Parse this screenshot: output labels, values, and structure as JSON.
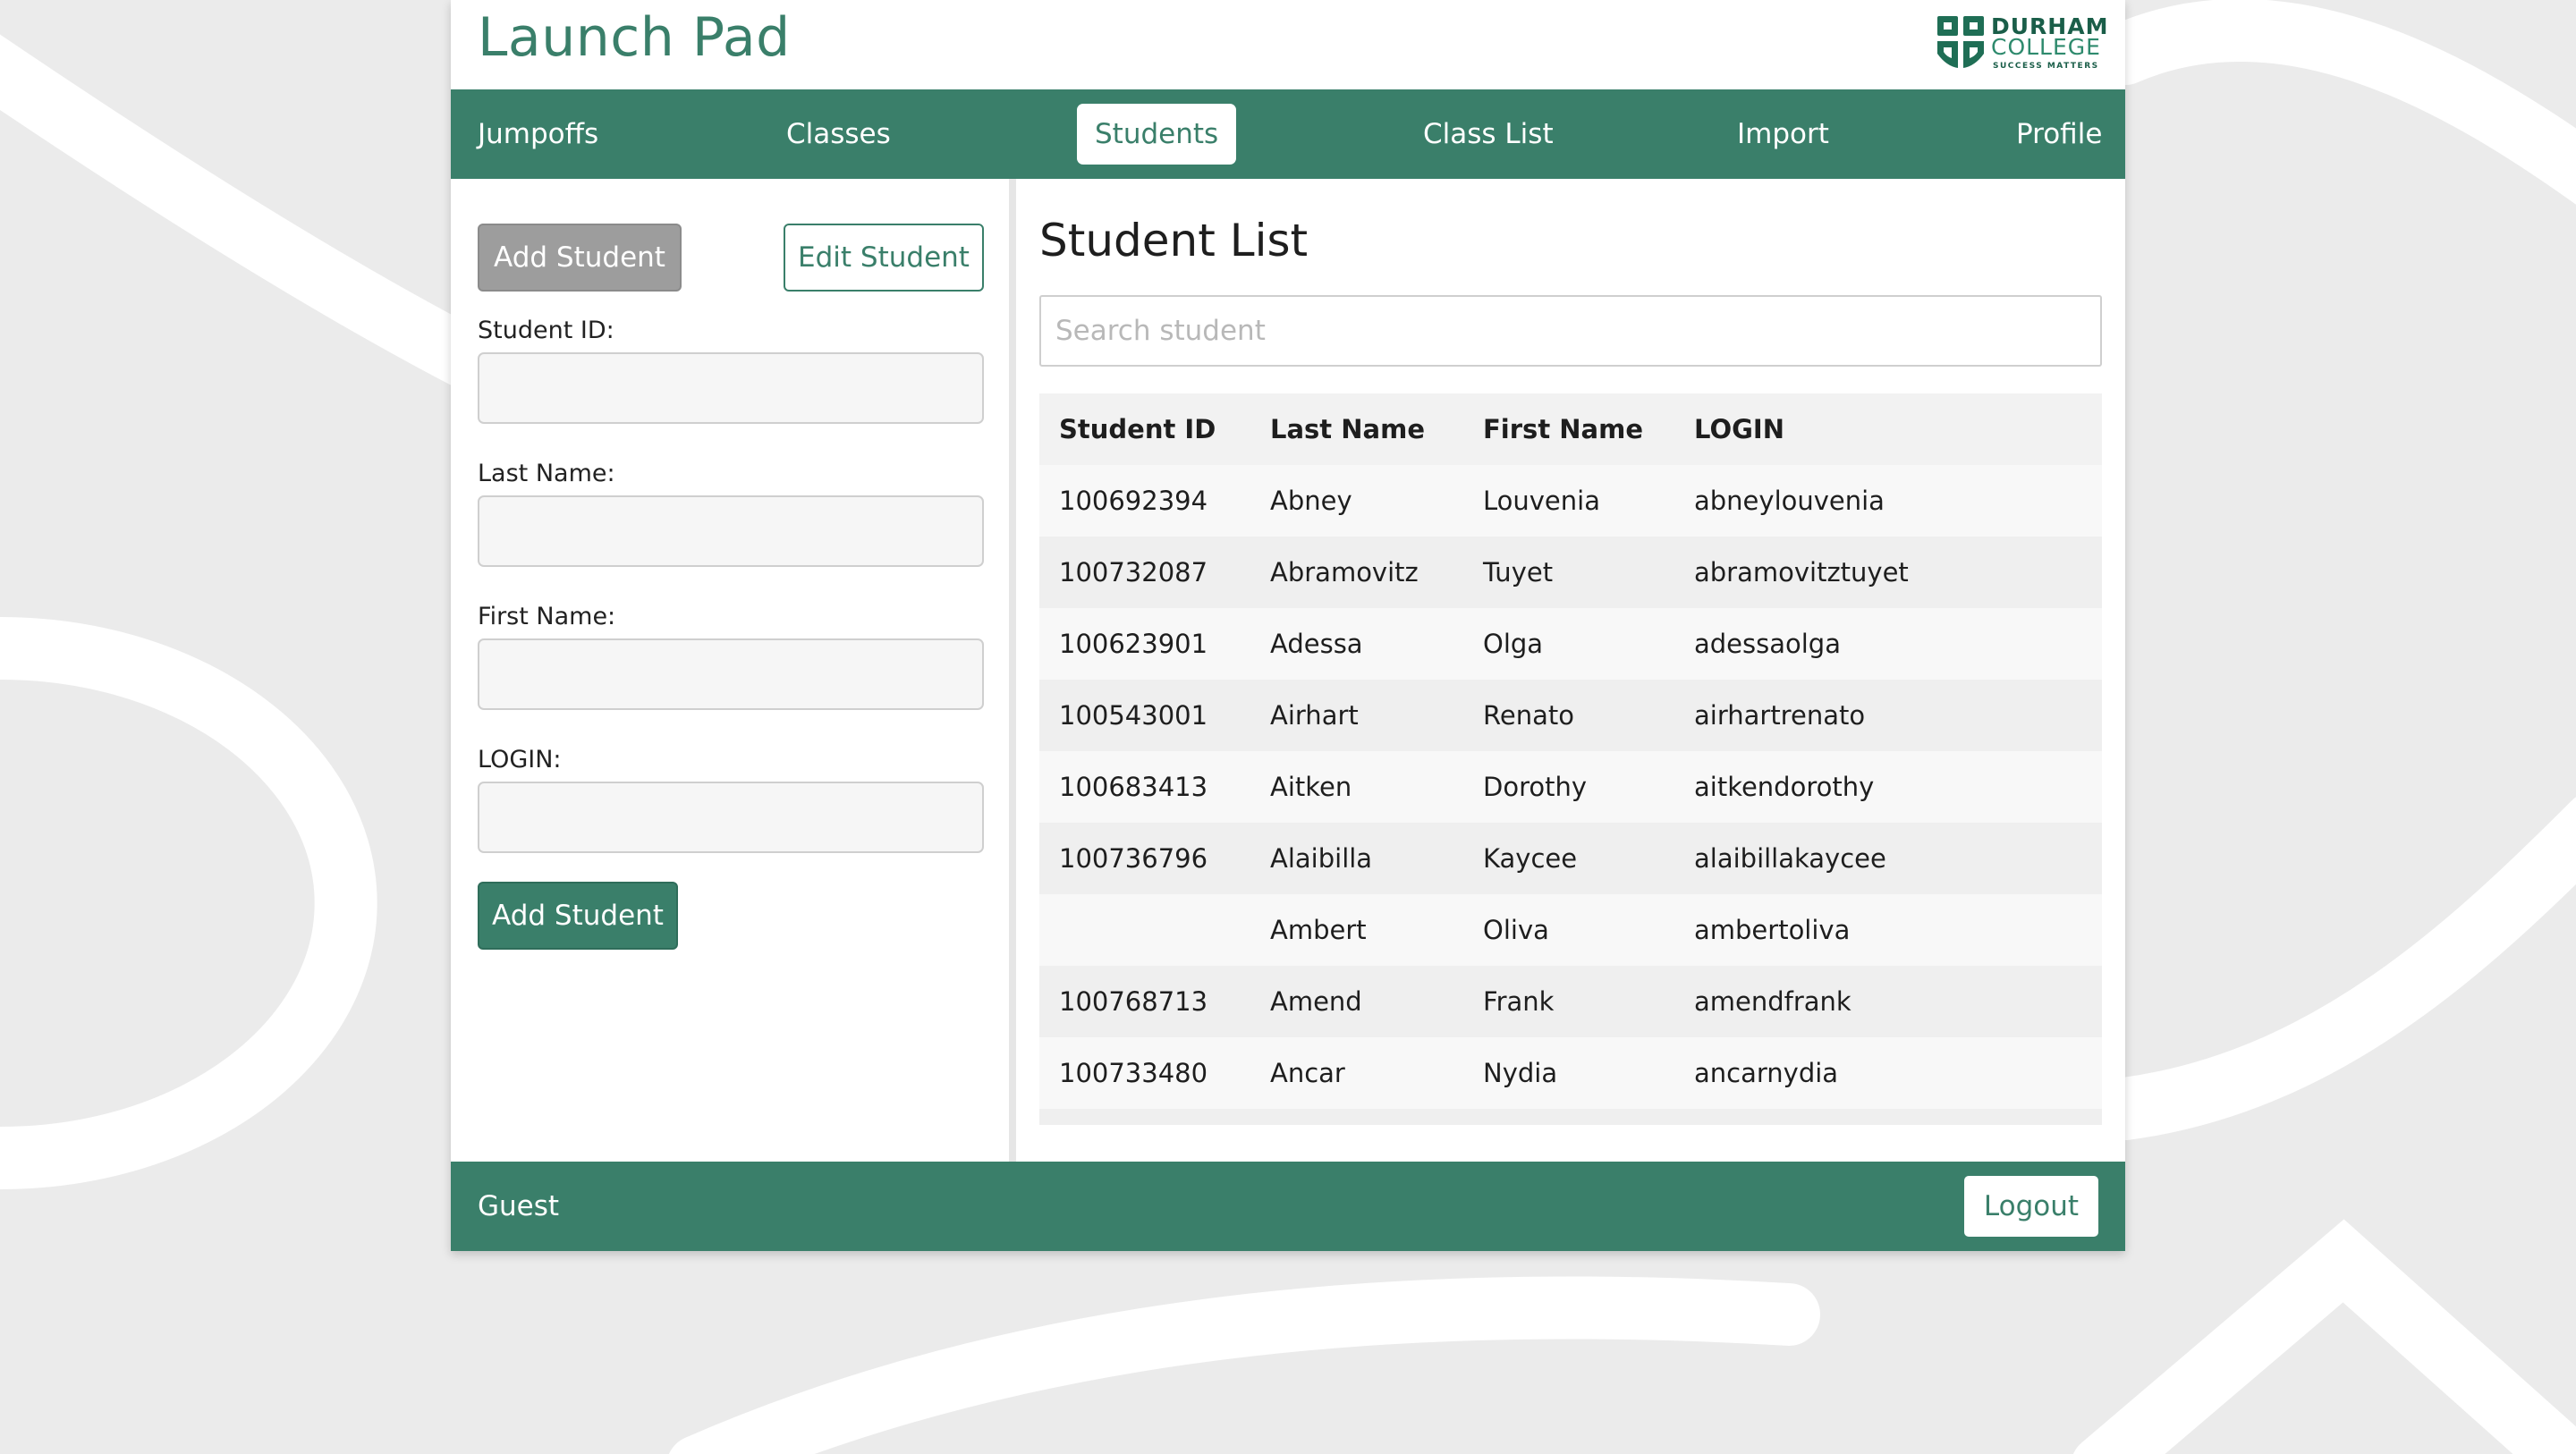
{
  "colors": {
    "brand": "#3a7f6a",
    "background": "#ebebeb",
    "button_gray": "#9d9d9d"
  },
  "app": {
    "title": "Launch Pad"
  },
  "logo": {
    "line1": "DURHAM",
    "line2": "COLLEGE",
    "line3": "SUCCESS MATTERS",
    "icon": "durham-college-shield-icon"
  },
  "nav": {
    "items": [
      {
        "label": "Jumpoffs",
        "active": false
      },
      {
        "label": "Classes",
        "active": false
      },
      {
        "label": "Students",
        "active": true
      },
      {
        "label": "Class List",
        "active": false
      },
      {
        "label": "Import",
        "active": false
      },
      {
        "label": "Profile",
        "active": false
      }
    ]
  },
  "form": {
    "add_mode_label": "Add Student",
    "edit_mode_label": "Edit Student",
    "fields": [
      {
        "label": "Student ID:",
        "value": ""
      },
      {
        "label": "Last Name:",
        "value": ""
      },
      {
        "label": "First Name:",
        "value": ""
      },
      {
        "label": "LOGIN:",
        "value": ""
      }
    ],
    "submit_label": "Add Student"
  },
  "student_list": {
    "title": "Student List",
    "search": {
      "placeholder": "Search student",
      "value": ""
    },
    "columns": [
      "Student ID",
      "Last Name",
      "First Name",
      "LOGIN"
    ],
    "rows": [
      [
        "100692394",
        "Abney",
        "Louvenia",
        "abneylouvenia"
      ],
      [
        "100732087",
        "Abramovitz",
        "Tuyet",
        "abramovitztuyet"
      ],
      [
        "100623901",
        "Adessa",
        "Olga",
        "adessaolga"
      ],
      [
        "100543001",
        "Airhart",
        "Renato",
        "airhartrenato"
      ],
      [
        "100683413",
        "Aitken",
        "Dorothy",
        "aitkendorothy"
      ],
      [
        "100736796",
        "Alaibilla",
        "Kaycee",
        "alaibillakaycee"
      ],
      [
        "",
        "Ambert",
        "Oliva",
        "ambertoliva"
      ],
      [
        "100768713",
        "Amend",
        "Frank",
        "amendfrank"
      ],
      [
        "100733480",
        "Ancar",
        "Nydia",
        "ancarnydia"
      ]
    ]
  },
  "footer": {
    "user": "Guest",
    "logout_label": "Logout"
  }
}
